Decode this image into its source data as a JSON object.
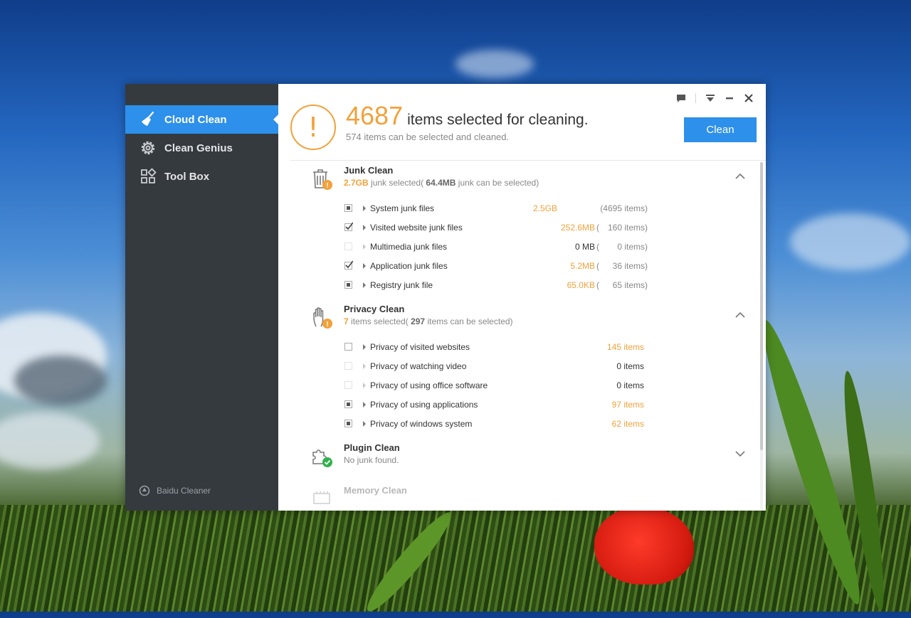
{
  "sidebar": {
    "items": [
      {
        "label": "Cloud Clean",
        "icon": "broom-icon",
        "active": true
      },
      {
        "label": "Clean Genius",
        "icon": "gear-icon",
        "active": false
      },
      {
        "label": "Tool Box",
        "icon": "grid-icon",
        "active": false
      }
    ],
    "brand": "Baidu Cleaner"
  },
  "header": {
    "count": "4687",
    "headline": "items selected for cleaning.",
    "sub_count": "574",
    "sub_text": "items can be selected and cleaned.",
    "clean_label": "Clean"
  },
  "controls": [
    "feedback-icon",
    "menu-icon",
    "minimize-icon",
    "close-icon"
  ],
  "colors": {
    "accent": "#2d90ea",
    "orange": "#f2a13a",
    "sidebar": "#353a3f",
    "success": "#2fb24c"
  },
  "sections": {
    "junk": {
      "title": "Junk Clean",
      "selected": "2.7GB",
      "selected_text": "junk selected(",
      "available": "64.4MB",
      "available_text": "junk can be selected)",
      "rows": [
        {
          "name": "System junk files",
          "size": "2.5GB",
          "count_open": "(4695 items)",
          "state": "partial"
        },
        {
          "name": "Visited website junk files",
          "size": "252.6MB",
          "paren": "(",
          "count": "160 items)",
          "state": "checked"
        },
        {
          "name": "Multimedia junk files",
          "size": "0 MB",
          "paren": "(",
          "count": "0 items)",
          "state": "disabled"
        },
        {
          "name": "Application junk files",
          "size": "5.2MB",
          "paren": "(",
          "count": "36 items)",
          "state": "checked"
        },
        {
          "name": "Registry junk file",
          "size": "65.0KB",
          "paren": "(",
          "count": "65 items)",
          "state": "partial"
        }
      ]
    },
    "privacy": {
      "title": "Privacy Clean",
      "selected": "7",
      "selected_text": "items selected(",
      "available": "297",
      "available_text": "items can be selected)",
      "rows": [
        {
          "name": "Privacy of visited websites",
          "count": "145 items",
          "state": "unchecked"
        },
        {
          "name": "Privacy of watching video",
          "count": "0 items",
          "state": "disabled"
        },
        {
          "name": "Privacy of using office software",
          "count": "0 items",
          "state": "disabled"
        },
        {
          "name": "Privacy of using applications",
          "count": "97 items",
          "state": "partial"
        },
        {
          "name": "Privacy of windows system",
          "count": "62 items",
          "state": "partial"
        }
      ]
    },
    "plugin": {
      "title": "Plugin Clean",
      "status": "No junk found."
    },
    "memory": {
      "title": "Memory Clean"
    }
  }
}
